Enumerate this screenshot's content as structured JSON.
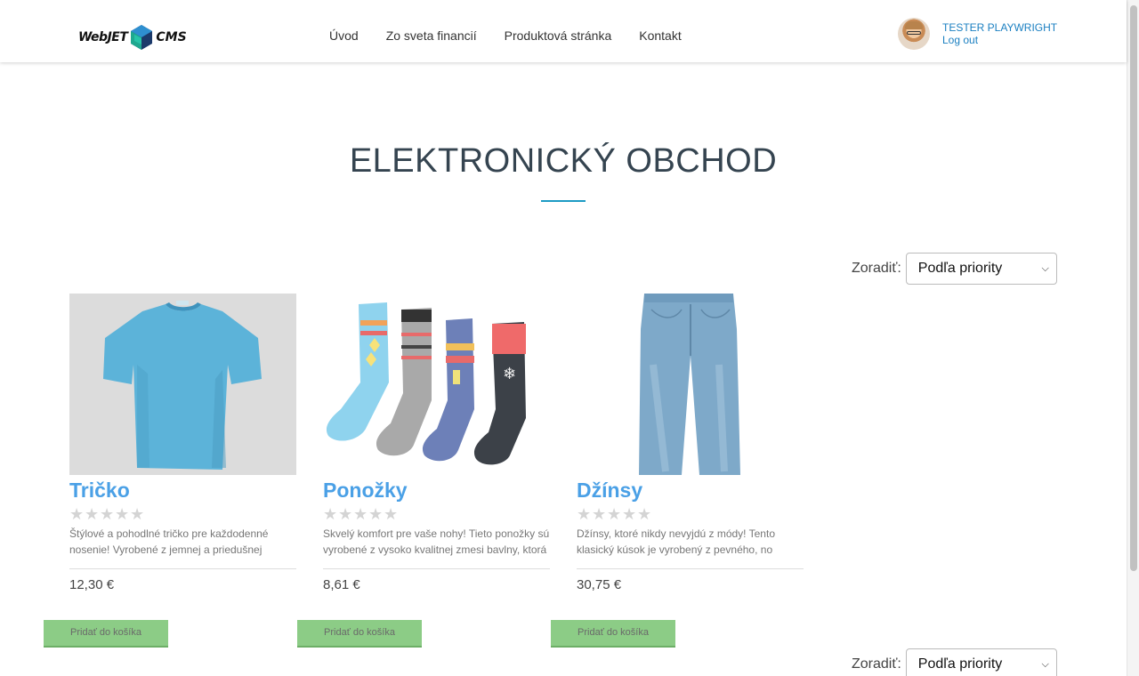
{
  "header": {
    "logo_left": "WebJET",
    "logo_right": "CMS",
    "nav": [
      "Úvod",
      "Zo sveta financií",
      "Produktová stránka",
      "Kontakt"
    ],
    "user_name": "TESTER PLAYWRIGHT",
    "logout": "Log out"
  },
  "main": {
    "title": "ELEKTRONICKÝ OBCHOD",
    "sort_label": "Zoradiť:",
    "sort_value": "Podľa priority"
  },
  "products": [
    {
      "name": "Tričko",
      "rating": 0,
      "description": "Štýlové a pohodlné tričko pre každodenné nosenie! Vyrobené z jemnej a priedušnej",
      "price": "12,30 €",
      "button": "Pridať do košíka"
    },
    {
      "name": "Ponožky",
      "rating": 0,
      "description": "Skvelý komfort pre vaše nohy! Tieto ponožky sú vyrobené z vysoko kvalitnej zmesi bavlny, ktorá",
      "price": "8,61 €",
      "button": "Pridať do košíka"
    },
    {
      "name": "Džínsy",
      "rating": 0,
      "description": "Džínsy, ktoré nikdy nevyjdú z módy! Tento klasický kúsok je vyrobený z pevného, no",
      "price": "30,75 €",
      "button": "Pridať do košíka"
    }
  ],
  "colors": {
    "accent": "#1c9bc4",
    "product_name": "#4aa0e6",
    "link": "#1a7fc1",
    "cart_button": "#8ccc86"
  },
  "icons": [
    "logo-mark-icon",
    "avatar",
    "star-icon",
    "chevron-down-icon"
  ]
}
